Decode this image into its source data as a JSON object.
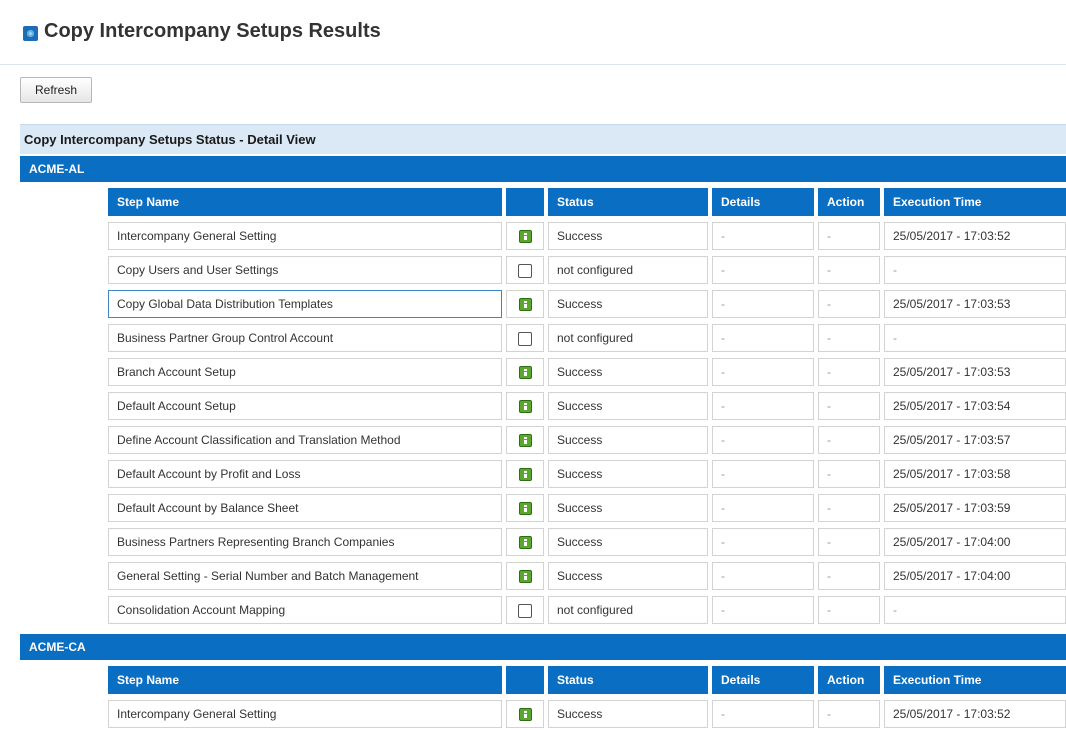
{
  "page": {
    "title": "Copy Intercompany Setups Results"
  },
  "toolbar": {
    "refresh_label": "Refresh"
  },
  "panel": {
    "title": "Copy Intercompany Setups Status - Detail View"
  },
  "table_headers": {
    "step_name": "Step Name",
    "status": "Status",
    "details": "Details",
    "action": "Action",
    "execution_time": "Execution Time"
  },
  "groups": [
    {
      "name": "ACME-AL",
      "rows": [
        {
          "step": "Intercompany General Setting",
          "icon": "info-icon",
          "status": "Success",
          "details": "-",
          "action": "-",
          "time": "25/05/2017 - 17:03:52"
        },
        {
          "step": "Copy Users and User Settings",
          "icon": "checkbox-icon",
          "status": "not configured",
          "details": "-",
          "action": "-",
          "time": "-"
        },
        {
          "step": "Copy Global Data Distribution Templates",
          "icon": "info-icon",
          "status": "Success",
          "details": "-",
          "action": "-",
          "time": "25/05/2017 - 17:03:53"
        },
        {
          "step": "Business Partner Group Control Account",
          "icon": "checkbox-icon",
          "status": "not configured",
          "details": "-",
          "action": "-",
          "time": "-"
        },
        {
          "step": "Branch Account Setup",
          "icon": "info-icon",
          "status": "Success",
          "details": "-",
          "action": "-",
          "time": "25/05/2017 - 17:03:53"
        },
        {
          "step": "Default Account Setup",
          "icon": "info-icon",
          "status": "Success",
          "details": "-",
          "action": "-",
          "time": "25/05/2017 - 17:03:54"
        },
        {
          "step": "Define Account Classification and Translation Method",
          "icon": "info-icon",
          "status": "Success",
          "details": "-",
          "action": "-",
          "time": "25/05/2017 - 17:03:57"
        },
        {
          "step": "Default Account by Profit and Loss",
          "icon": "info-icon",
          "status": "Success",
          "details": "-",
          "action": "-",
          "time": "25/05/2017 - 17:03:58"
        },
        {
          "step": "Default Account by Balance Sheet",
          "icon": "info-icon",
          "status": "Success",
          "details": "-",
          "action": "-",
          "time": "25/05/2017 - 17:03:59"
        },
        {
          "step": "Business Partners Representing Branch Companies",
          "icon": "info-icon",
          "status": "Success",
          "details": "-",
          "action": "-",
          "time": "25/05/2017 - 17:04:00"
        },
        {
          "step": "General Setting - Serial Number and Batch Management",
          "icon": "info-icon",
          "status": "Success",
          "details": "-",
          "action": "-",
          "time": "25/05/2017 - 17:04:00"
        },
        {
          "step": "Consolidation Account Mapping",
          "icon": "checkbox-icon",
          "status": "not configured",
          "details": "-",
          "action": "-",
          "time": "-"
        }
      ]
    },
    {
      "name": "ACME-CA",
      "rows": [
        {
          "step": "Intercompany General Setting",
          "icon": "info-icon",
          "status": "Success",
          "details": "-",
          "action": "-",
          "time": "25/05/2017 - 17:03:52"
        }
      ]
    }
  ],
  "colors": {
    "accent": "#0a6fc2",
    "panel_bg": "#dbe9f6",
    "success_icon": "#5aa62f"
  }
}
